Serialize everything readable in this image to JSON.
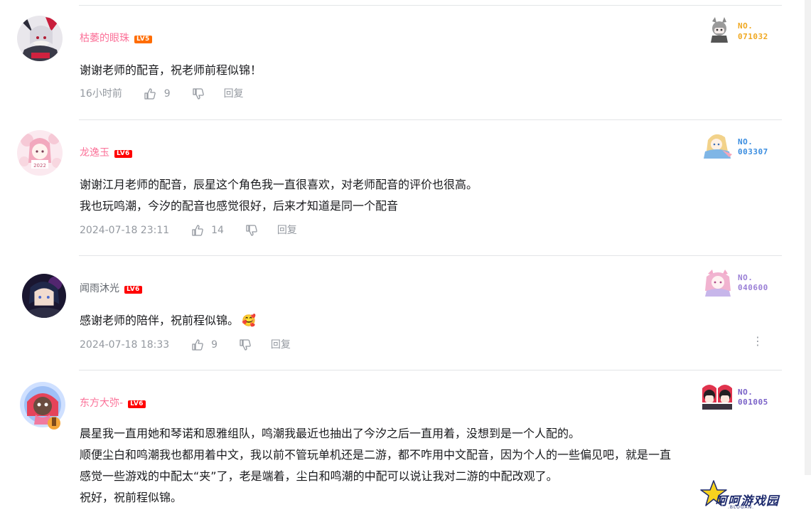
{
  "colors": {
    "pink_name": "#fb7299",
    "plain_name": "#61666d",
    "lv5": "#ff6c00",
    "lv6": "#ff0000",
    "meta": "#9499a0"
  },
  "comments": [
    {
      "username": "枯萎的眼珠",
      "level": "LV5",
      "lines": [
        "谢谢老师的配音，祝老师前程似锦！"
      ],
      "time": "16小时前",
      "likes": "9",
      "reply_label": "回复",
      "fan_no_label": "NO.",
      "fan_no": "071032",
      "fan_color": "#f0a820"
    },
    {
      "username": "龙逸玉",
      "level": "LV6",
      "lines": [
        "谢谢江月老师的配音，辰星这个角色我一直很喜欢，对老师配音的评价也很高。",
        "我也玩鸣潮，今汐的配音也感觉很好，后来才知道是同一个配音"
      ],
      "time": "2024-07-18 23:11",
      "likes": "14",
      "reply_label": "回复",
      "fan_no_label": "NO.",
      "fan_no": "003307",
      "fan_color": "#3a8de0"
    },
    {
      "username": "闻雨沐光",
      "level": "LV6",
      "lines": [
        "感谢老师的陪伴，祝前程似锦。"
      ],
      "emoji": "🥰",
      "time": "2024-07-18 18:33",
      "likes": "9",
      "reply_label": "回复",
      "fan_no_label": "NO.",
      "fan_no": "040600",
      "fan_color": "#9a7fd6"
    },
    {
      "username": "东方大弥-",
      "level": "LV6",
      "lines": [
        "晨星我一直用她和琴诺和恩雅组队，鸣潮我最近也抽出了今汐之后一直用着，没想到是一个人配的。",
        "顺便尘白和鸣潮我也都用着中文，我以前不管玩单机还是二游，都不咋用中文配音，因为个人的一些偏见吧，就是一直",
        "感觉一些游戏的中配太“夹”了，老是端着，尘白和鸣潮的中配可以说让我对二游的中配改观了。",
        "祝好，祝前程似锦。"
      ],
      "fan_no_label": "NO.",
      "fan_no": "001005",
      "fan_color": "#7a62c8"
    }
  ],
  "more_icon": "⋮",
  "watermark": {
    "text": "呵呵游戏园",
    "sub": ".BLOGAN."
  }
}
